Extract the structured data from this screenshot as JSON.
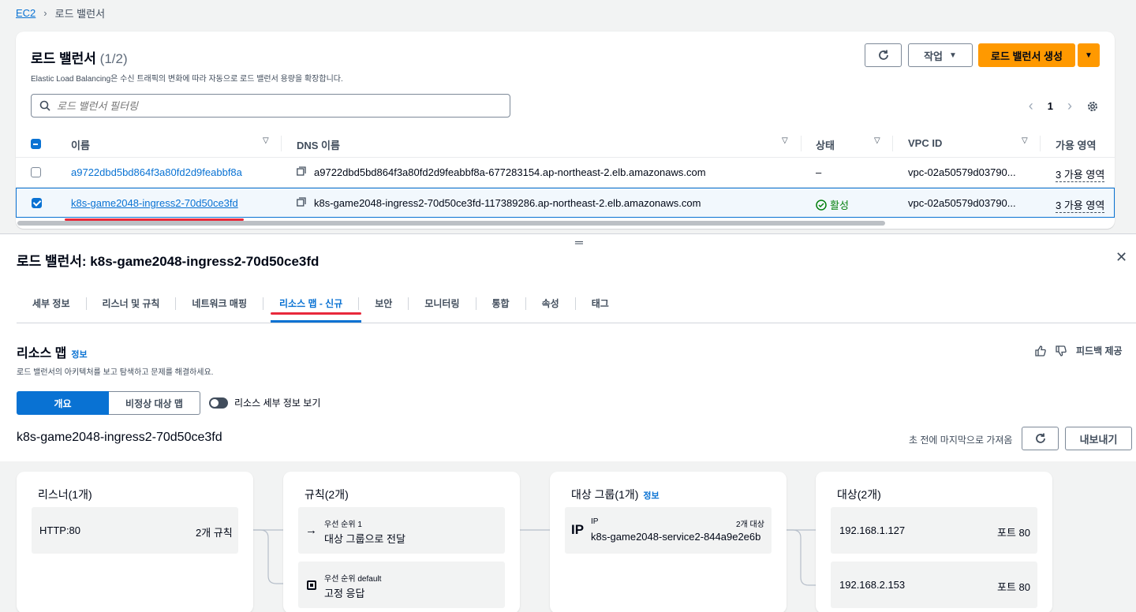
{
  "breadcrumb": {
    "root": "EC2",
    "current": "로드 밸런서"
  },
  "list": {
    "title": "로드 밸런서",
    "count": "(1/2)",
    "description": "Elastic Load Balancing은 수신 트래픽의 변화에 따라 자동으로 로드 밸런서 용량을 확장합니다.",
    "actions_label": "작업",
    "create_label": "로드 밸런서 생성",
    "search_placeholder": "로드 밸런서 필터링",
    "page": "1",
    "columns": [
      "이름",
      "DNS 이름",
      "상태",
      "VPC ID",
      "가용 영역"
    ],
    "rows": [
      {
        "name": "a9722dbd5bd864f3a80fd2d9feabbf8a",
        "dns": "a9722dbd5bd864f3a80fd2d9feabbf8a-677283154.ap-northeast-2.elb.amazonaws.com",
        "state": "–",
        "vpc": "vpc-02a50579d03790...",
        "az": "3 가용 영역",
        "selected": false
      },
      {
        "name": "k8s-game2048-ingress2-70d50ce3fd",
        "dns": "k8s-game2048-ingress2-70d50ce3fd-117389286.ap-northeast-2.elb.amazonaws.com",
        "state": "활성",
        "vpc": "vpc-02a50579d03790...",
        "az": "3 가용 영역",
        "selected": true
      }
    ]
  },
  "detail": {
    "title": "로드 밸런서: k8s-game2048-ingress2-70d50ce3fd",
    "tabs": [
      "세부 정보",
      "리스너 및 규칙",
      "네트워크 매핑",
      "리소스 맵 - 신규",
      "보안",
      "모니터링",
      "통합",
      "속성",
      "태그"
    ],
    "active_tab": "리소스 맵 - 신규",
    "section_title": "리소스 맵",
    "info": "정보",
    "section_desc": "로드 밸런서의 아키텍처를 보고 탐색하고 문제를 해결하세요.",
    "feedback": "피드백 제공",
    "seg_overview": "개요",
    "seg_unhealthy": "비정상 대상 맵",
    "toggle_label": "리소스 세부 정보 보기",
    "lb_name": "k8s-game2048-ingress2-70d50ce3fd",
    "fetched": "초 전에 마지막으로 가져옴",
    "export": "내보내기"
  },
  "map": {
    "listeners": {
      "title": "리스너(1개)",
      "items": [
        {
          "name": "HTTP:80",
          "rules": "2개 규칙"
        }
      ]
    },
    "rules": {
      "title": "규칙(2개)",
      "items": [
        {
          "priority": "우선 순위 1",
          "action": "대상 그룹으로 전달"
        },
        {
          "priority": "우선 순위 default",
          "action": "고정 응답"
        }
      ]
    },
    "target_groups": {
      "title": "대상 그룹(1개)",
      "info": "정보",
      "items": [
        {
          "type": "IP",
          "count": "2개 대상",
          "name": "k8s-game2048-service2-844a9e2e6b"
        }
      ]
    },
    "targets": {
      "title": "대상(2개)",
      "items": [
        {
          "ip": "192.168.1.127",
          "port": "포트 80"
        },
        {
          "ip": "192.168.2.153",
          "port": "포트 80"
        }
      ]
    }
  },
  "colors": {
    "link": "#0972d3",
    "primary": "#ff9900",
    "success": "#037f0c",
    "highlight": "#e8293b"
  }
}
